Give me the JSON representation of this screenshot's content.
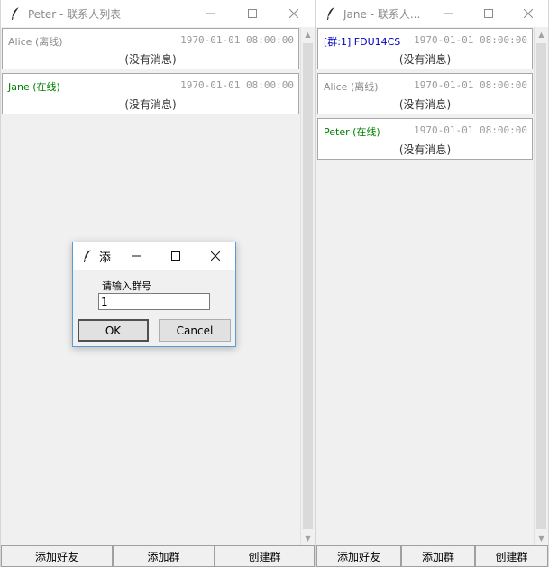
{
  "windows": {
    "peter": {
      "title": "Peter - 联系人列表",
      "contacts": [
        {
          "name": "Alice (离线)",
          "time": "1970-01-01 08:00:00",
          "message": "(没有消息)",
          "name_color": "#8a8a8a"
        },
        {
          "name": "Jane (在线)",
          "time": "1970-01-01 08:00:00",
          "message": "(没有消息)",
          "name_color": "#008000"
        }
      ],
      "buttons": {
        "add_friend": "添加好友",
        "add_group": "添加群",
        "create_group": "创建群"
      }
    },
    "jane": {
      "title": "Jane - 联系人...",
      "contacts": [
        {
          "name": "[群:1] FDU14CS",
          "time": "1970-01-01 08:00:00",
          "message": "(没有消息)",
          "name_color": "#0000c0"
        },
        {
          "name": "Alice (离线)",
          "time": "1970-01-01 08:00:00",
          "message": "(没有消息)",
          "name_color": "#8a8a8a"
        },
        {
          "name": "Peter (在线)",
          "time": "1970-01-01 08:00:00",
          "message": "(没有消息)",
          "name_color": "#008000"
        }
      ],
      "buttons": {
        "add_friend": "添加好友",
        "add_group": "添加群",
        "create_group": "创建群"
      }
    }
  },
  "dialog": {
    "title": "添",
    "prompt": "请输入群号",
    "input_value": "1",
    "ok_label": "OK",
    "cancel_label": "Cancel"
  },
  "icons": {
    "app": "feather-icon",
    "minimize": "minimize-icon",
    "maximize": "maximize-icon",
    "close": "close-icon"
  },
  "colors": {
    "offline": "#8a8a8a",
    "online": "#008000",
    "group": "#0000c0",
    "dialog_border": "#5b9bd5"
  }
}
